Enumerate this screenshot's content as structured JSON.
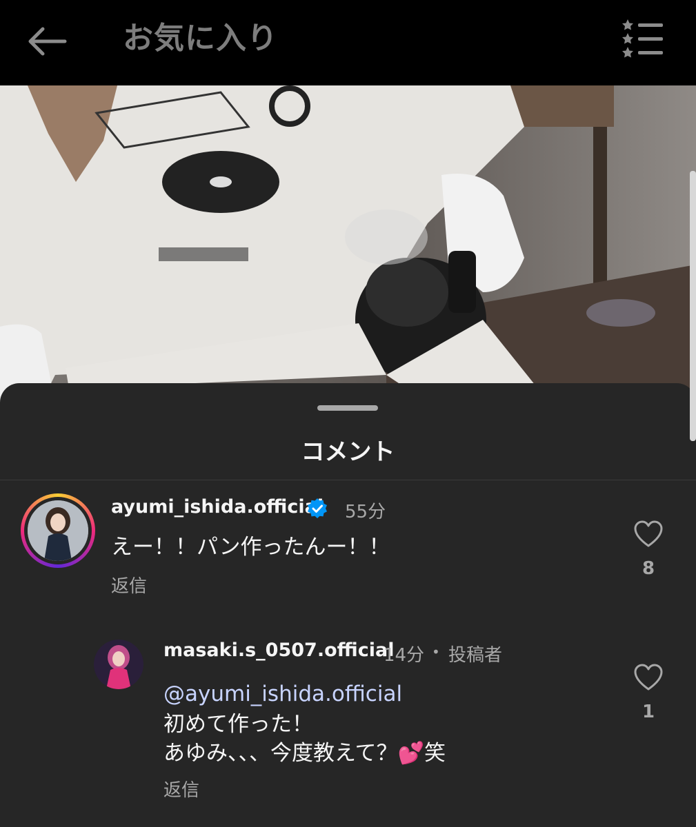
{
  "header": {
    "title": "お気に入り"
  },
  "sheet": {
    "title": "コメント"
  },
  "comments": [
    {
      "username": "ayumi_ishida.official",
      "verified": true,
      "time": "55分",
      "text": "えー！！パン作ったんー！！",
      "reply_label": "返信",
      "likes": "8"
    },
    {
      "username": "masaki.s_0507.official",
      "time": "14分",
      "separator": "•",
      "author_tag": "投稿者",
      "mention": "@ayumi_ishida.official",
      "line2": "初めて作った！",
      "line3": "あゆみ、、、今度教えて？💕笑",
      "reply_label": "返信",
      "likes": "1"
    }
  ],
  "icons": {
    "back": "back-arrow-icon",
    "filter": "star-list-filter-icon",
    "verified": "verified-badge-icon",
    "like": "heart-icon"
  },
  "colors": {
    "sheet_bg": "#262626",
    "verified_blue": "#0095f6",
    "muted_text": "#a8a8a8"
  }
}
